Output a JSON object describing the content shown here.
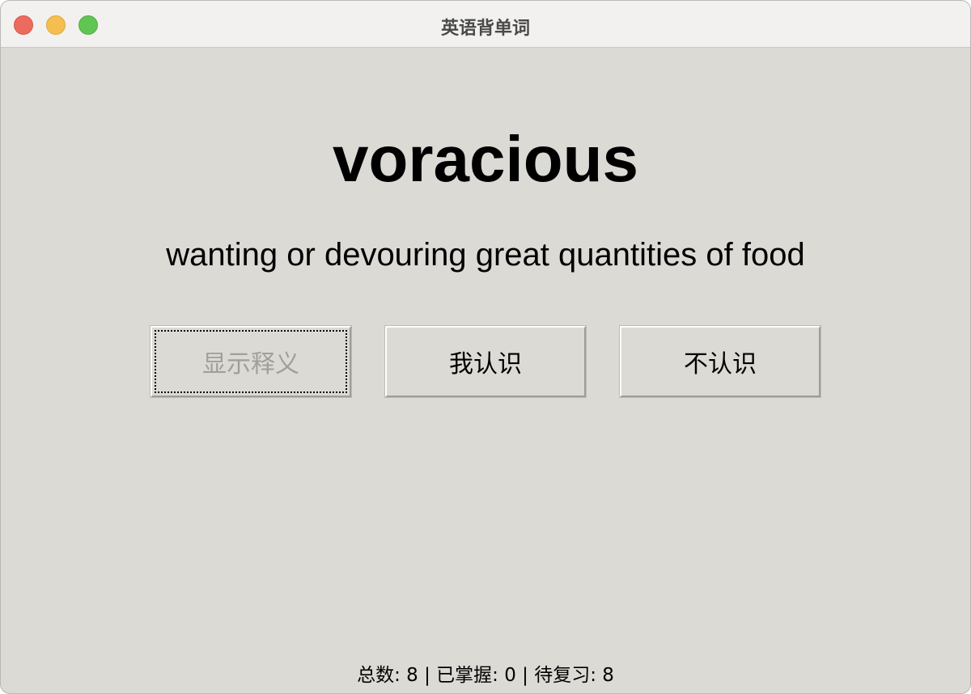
{
  "window": {
    "title": "英语背单词"
  },
  "card": {
    "word": "voracious",
    "definition": "wanting or devouring great quantities of food"
  },
  "buttons": {
    "show_meaning": "显示释义",
    "know": "我认识",
    "dont_know": "不认识"
  },
  "status": {
    "text": "总数: 8 | 已掌握: 0 | 待复习: 8",
    "total": 8,
    "mastered": 0,
    "review": 8
  },
  "colors": {
    "background": "#dcdad5",
    "titlebar": "#f2f1ef",
    "disabled_text": "#a19f9b",
    "close": "#ed6a5e",
    "minimize": "#f5be4f",
    "zoom": "#61c554"
  }
}
